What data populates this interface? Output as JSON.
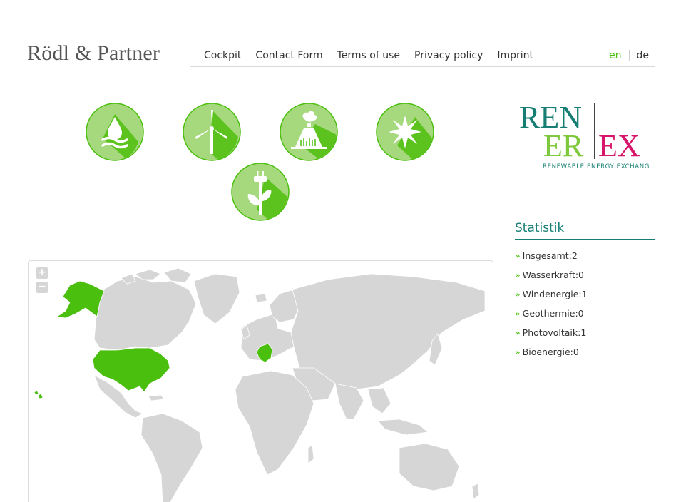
{
  "header": {
    "brand": "Rödl & Partner",
    "nav": [
      "Cockpit",
      "Contact Form",
      "Terms of use",
      "Privacy policy",
      "Imprint"
    ],
    "lang_en": "en",
    "lang_de": "de"
  },
  "logo": {
    "line1": "REN",
    "line2_left": "ER",
    "line2_right": "EX",
    "tagline": "RENEWABLE ENERGY EXCHANGE"
  },
  "energy_icons": [
    "water-energy-icon",
    "wind-energy-icon",
    "geothermal-energy-icon",
    "solar-energy-icon",
    "bioenergy-icon"
  ],
  "stats": {
    "title": "Statistik",
    "items": [
      "Insgesamt:2",
      "Wasserkraft:0",
      "Windenergie:1",
      "Geothermie:0",
      "Photovoltaik:1",
      "Bioenergie:0"
    ]
  },
  "map": {
    "zoom_in": "+",
    "zoom_out": "−",
    "highlighted_countries": [
      "Alaska",
      "United States",
      "Germany"
    ]
  },
  "colors": {
    "accent_green": "#4bbf0e",
    "icon_light": "#a6d97d",
    "teal": "#177e73",
    "magenta": "#d6156b",
    "land_grey": "#d6d6d6"
  }
}
